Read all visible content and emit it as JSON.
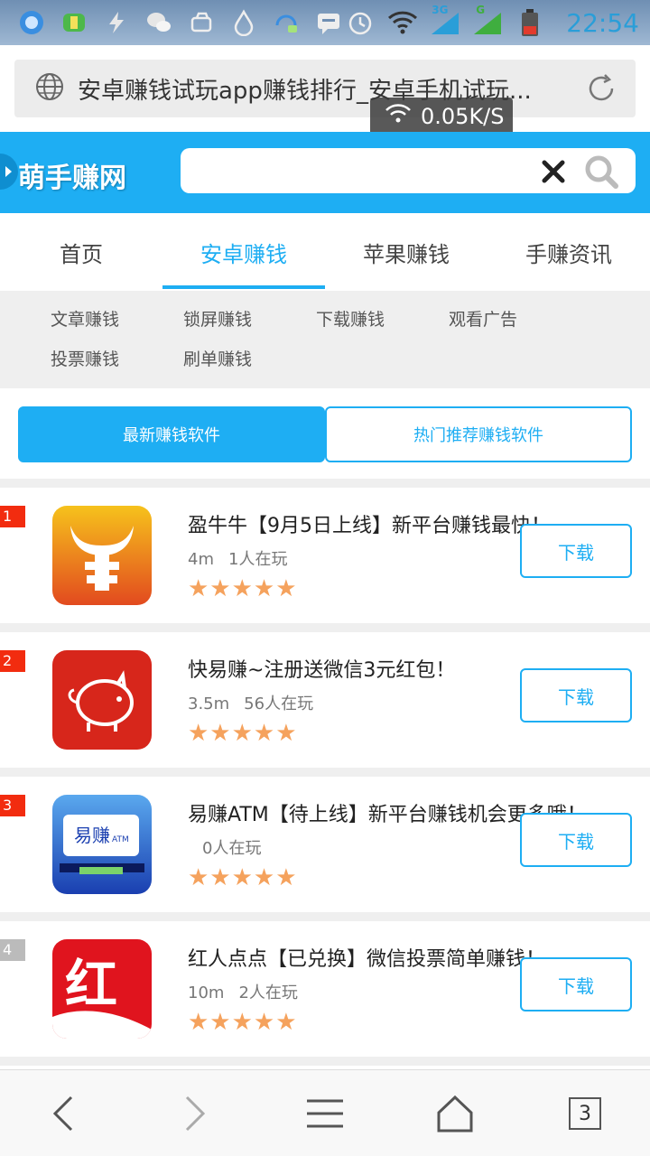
{
  "status_bar": {
    "time": "22:54",
    "icons": [
      "qq-browser-icon",
      "game-icon",
      "flash-icon",
      "wechat-icon",
      "cloud-icon",
      "drop-icon",
      "headset-icon",
      "message-icon",
      "alarm-icon",
      "wifi-icon",
      "signal-3g-icon",
      "signal-g-icon",
      "battery-icon"
    ],
    "net_3g": "3G",
    "net_g": "G"
  },
  "address_bar": {
    "title": "安卓赚钱试玩app赚钱排行_安卓手机试玩...",
    "speed": "0.05K/S"
  },
  "site": {
    "logo": "萌手赚网",
    "search_placeholder": ""
  },
  "main_nav": [
    {
      "label": "首页",
      "active": false
    },
    {
      "label": "安卓赚钱",
      "active": true
    },
    {
      "label": "苹果赚钱",
      "active": false
    },
    {
      "label": "手赚资讯",
      "active": false
    }
  ],
  "sub_nav": [
    "文章赚钱",
    "锁屏赚钱",
    "下载赚钱",
    "观看广告",
    "投票赚钱",
    "刷单赚钱"
  ],
  "switch_tabs": {
    "latest": "最新赚钱软件",
    "hot": "热门推荐赚钱软件"
  },
  "apps": [
    {
      "rank": "1",
      "title": "盈牛牛【9月5日上线】新平台赚钱最快！",
      "size": "4m",
      "players": "1人在玩",
      "stars": "★★★★★",
      "download": "下载"
    },
    {
      "rank": "2",
      "title": "快易赚~注册送微信3元红包！",
      "size": "3.5m",
      "players": "56人在玩",
      "stars": "★★★★★",
      "download": "下载"
    },
    {
      "rank": "3",
      "title": "易赚ATM【待上线】新平台赚钱机会更多哦！",
      "size": "",
      "players": "0人在玩",
      "stars": "★★★★★",
      "download": "下载"
    },
    {
      "rank": "4",
      "title": "红人点点【已兑换】微信投票简单赚钱！",
      "size": "10m",
      "players": "2人在玩",
      "stars": "★★★★★",
      "download": "下载"
    }
  ],
  "app_icon_text": {
    "atm_brand": "易赚",
    "atm_small": "ATM",
    "red_char": "红"
  },
  "toolbar": {
    "tab_count": "3"
  },
  "colors": {
    "accent": "#1eaef3",
    "star": "#f5a25d",
    "rank_red": "#f22c0f",
    "rank_gray": "#bbbbbb"
  }
}
